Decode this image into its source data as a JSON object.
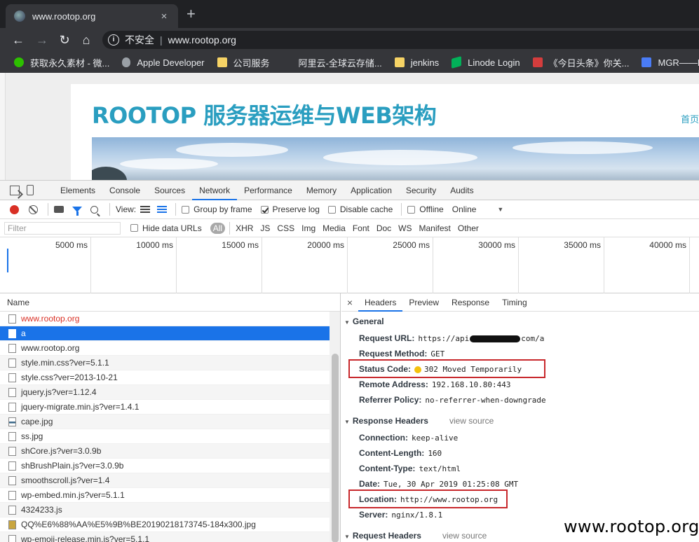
{
  "browser": {
    "tab_title": "www.rootop.org",
    "tab_close": "×",
    "new_tab": "+",
    "security_label": "不安全",
    "address_sep": "|",
    "url": "www.rootop.org",
    "bookmarks": [
      {
        "label": "获取永久素材 - 微...",
        "icon": "wechat"
      },
      {
        "label": "Apple Developer",
        "icon": "apple"
      },
      {
        "label": "公司服务",
        "icon": "folder"
      },
      {
        "label": "阿里云-全球云存储...",
        "icon": "aliyun"
      },
      {
        "label": "jenkins",
        "icon": "folder"
      },
      {
        "label": "Linode Login",
        "icon": "linode"
      },
      {
        "label": "《今日头条》你关...",
        "icon": "toutiao"
      },
      {
        "label": "MGR——My",
        "icon": "mgr"
      }
    ]
  },
  "site": {
    "title": "ROOTOP 服务器运维与WEB架构",
    "nav_first": "首页"
  },
  "devtools": {
    "tabs": [
      "Elements",
      "Console",
      "Sources",
      "Network",
      "Performance",
      "Memory",
      "Application",
      "Security",
      "Audits"
    ],
    "active_tab": "Network",
    "toolbar": {
      "view_label": "View:",
      "group_by_frame": "Group by frame",
      "preserve_log": "Preserve log",
      "disable_cache": "Disable cache",
      "offline": "Offline",
      "throttle": "Online"
    },
    "filter": {
      "placeholder": "Filter",
      "hide_data_urls": "Hide data URLs",
      "types": [
        "All",
        "XHR",
        "JS",
        "CSS",
        "Img",
        "Media",
        "Font",
        "Doc",
        "WS",
        "Manifest",
        "Other"
      ]
    },
    "overview_ticks": [
      "5000 ms",
      "10000 ms",
      "15000 ms",
      "20000 ms",
      "25000 ms",
      "30000 ms",
      "35000 ms",
      "40000 ms"
    ],
    "list_header": "Name",
    "requests": [
      {
        "name": "www.rootop.org",
        "state": "error",
        "icon": "doc"
      },
      {
        "name": "a",
        "state": "selected",
        "icon": "doc"
      },
      {
        "name": "www.rootop.org",
        "state": "normal",
        "icon": "doc"
      },
      {
        "name": "style.min.css?ver=5.1.1",
        "state": "normal",
        "icon": "doc"
      },
      {
        "name": "style.css?ver=2013-10-21",
        "state": "normal",
        "icon": "doc"
      },
      {
        "name": "jquery.js?ver=1.12.4",
        "state": "normal",
        "icon": "doc"
      },
      {
        "name": "jquery-migrate.min.js?ver=1.4.1",
        "state": "normal",
        "icon": "doc"
      },
      {
        "name": "cape.jpg",
        "state": "normal",
        "icon": "img"
      },
      {
        "name": "ss.jpg",
        "state": "normal",
        "icon": "doc"
      },
      {
        "name": "shCore.js?ver=3.0.9b",
        "state": "normal",
        "icon": "doc"
      },
      {
        "name": "shBrushPlain.js?ver=3.0.9b",
        "state": "normal",
        "icon": "doc"
      },
      {
        "name": "smoothscroll.js?ver=1.4",
        "state": "normal",
        "icon": "doc"
      },
      {
        "name": "wp-embed.min.js?ver=5.1.1",
        "state": "normal",
        "icon": "doc"
      },
      {
        "name": "4324233.js",
        "state": "normal",
        "icon": "doc"
      },
      {
        "name": "QQ%E6%88%AA%E5%9B%BE20190218173745-184x300.jpg",
        "state": "normal",
        "icon": "pic"
      },
      {
        "name": "wp-emoji-release.min.js?ver=5.1.1",
        "state": "normal",
        "icon": "doc"
      }
    ],
    "detail_tabs": [
      "Headers",
      "Preview",
      "Response",
      "Timing"
    ],
    "detail_close": "×",
    "general": {
      "title": "General",
      "request_url_key": "Request URL:",
      "request_url_prefix": "https://api",
      "request_url_suffix": "com/a",
      "request_method_key": "Request Method:",
      "request_method": "GET",
      "status_code_key": "Status Code:",
      "status_code": "302 Moved Temporarily",
      "remote_address_key": "Remote Address:",
      "remote_address": "192.168.10.80:443",
      "referrer_policy_key": "Referrer Policy:",
      "referrer_policy": "no-referrer-when-downgrade"
    },
    "response_headers": {
      "title": "Response Headers",
      "view_source": "view source",
      "connection_key": "Connection:",
      "connection": "keep-alive",
      "content_length_key": "Content-Length:",
      "content_length": "160",
      "content_type_key": "Content-Type:",
      "content_type": "text/html",
      "date_key": "Date:",
      "date": "Tue, 30 Apr 2019 01:25:08 GMT",
      "location_key": "Location:",
      "location": "http://www.rootop.org",
      "server_key": "Server:",
      "server": "nginx/1.8.1"
    },
    "request_headers": {
      "title": "Request Headers",
      "view_source": "view source"
    }
  },
  "watermark": "www.rootop.org",
  "colors": {
    "accent": "#1a73e8",
    "record": "#d93025",
    "highlight_box": "#c8282c",
    "status_dot": "#f4c20d",
    "site_title": "#2a9ec0"
  }
}
